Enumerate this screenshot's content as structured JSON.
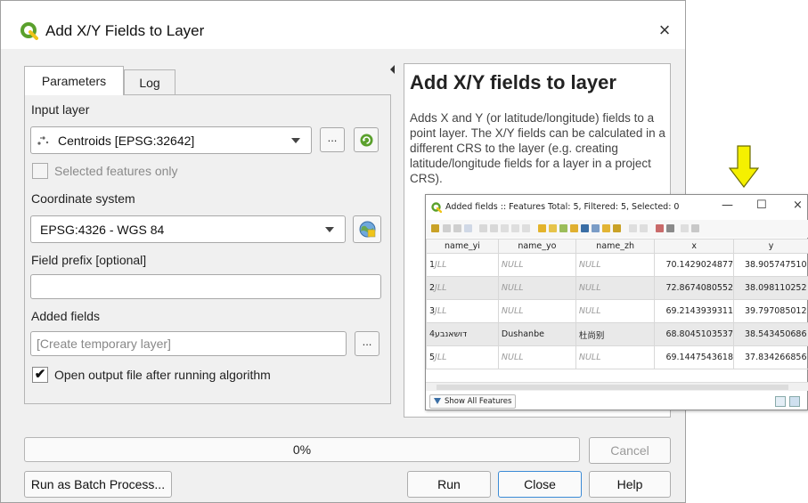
{
  "dialog": {
    "title": "Add X/Y Fields to Layer",
    "close_glyph": "×",
    "tabs": [
      {
        "label": "Parameters",
        "active": true
      },
      {
        "label": "Log",
        "active": false
      }
    ],
    "input_layer": {
      "label": "Input layer",
      "value": "Centroids [EPSG:32642]",
      "browse_label": "..."
    },
    "selected_only": {
      "label": "Selected features only",
      "checked": false
    },
    "coordinate_system": {
      "label": "Coordinate system",
      "value": "EPSG:4326 - WGS 84"
    },
    "field_prefix": {
      "label": "Field prefix [optional]",
      "value": ""
    },
    "added_fields": {
      "label": "Added fields",
      "placeholder": "[Create temporary layer]",
      "browse_label": "..."
    },
    "open_output": {
      "label": "Open output file after running algorithm",
      "checked": true,
      "check_glyph": "✔"
    },
    "help": {
      "heading": "Add X/Y fields to layer",
      "description": "Adds X and Y (or latitude/longitude) fields to a point layer. The X/Y fields can be calculated in a different CRS to the layer (e.g. creating latitude/longitude fields for a layer in a project CRS)."
    },
    "progress": {
      "value": 0,
      "label": "0%"
    },
    "buttons": {
      "cancel": "Cancel",
      "batch": "Run as Batch Process...",
      "run": "Run",
      "close": "Close",
      "help": "Help"
    },
    "colors": {
      "qgis_green": "#5aa02c",
      "qgis_yellow": "#f0c419",
      "focus_blue": "#3b8bd6"
    }
  },
  "attribute_table": {
    "title": "Added fields :: Features Total: 5, Filtered: 5, Selected: 0",
    "window_buttons": {
      "minimize": "—",
      "maximize": "☐",
      "close": "×"
    },
    "columns": [
      "name_yi",
      "name_yo",
      "name_zh",
      "x",
      "y"
    ],
    "rows": [
      {
        "num": "1",
        "name_yi": "JLL",
        "name_yo": "NULL",
        "name_zh": "NULL",
        "x": "70.1429024877",
        "y": "38.905747510"
      },
      {
        "num": "2",
        "name_yi": "JLL",
        "name_yo": "NULL",
        "name_zh": "NULL",
        "x": "72.8674080552",
        "y": "38.098110252"
      },
      {
        "num": "3",
        "name_yi": "JLL",
        "name_yo": "NULL",
        "name_zh": "NULL",
        "x": "69.2143939311",
        "y": "39.797085012"
      },
      {
        "num": "4",
        "name_yi": "דושאנבע",
        "name_yo": "Dushanbe",
        "name_zh": "杜尚别",
        "x": "68.8045103537",
        "y": "38.543450686"
      },
      {
        "num": "5",
        "name_yi": "JLL",
        "name_yo": "NULL",
        "name_zh": "NULL",
        "x": "69.1447543618",
        "y": "37.834266856"
      }
    ],
    "show_all_label": "Show All Features",
    "highlight_arrow_color": "#f5f000"
  }
}
